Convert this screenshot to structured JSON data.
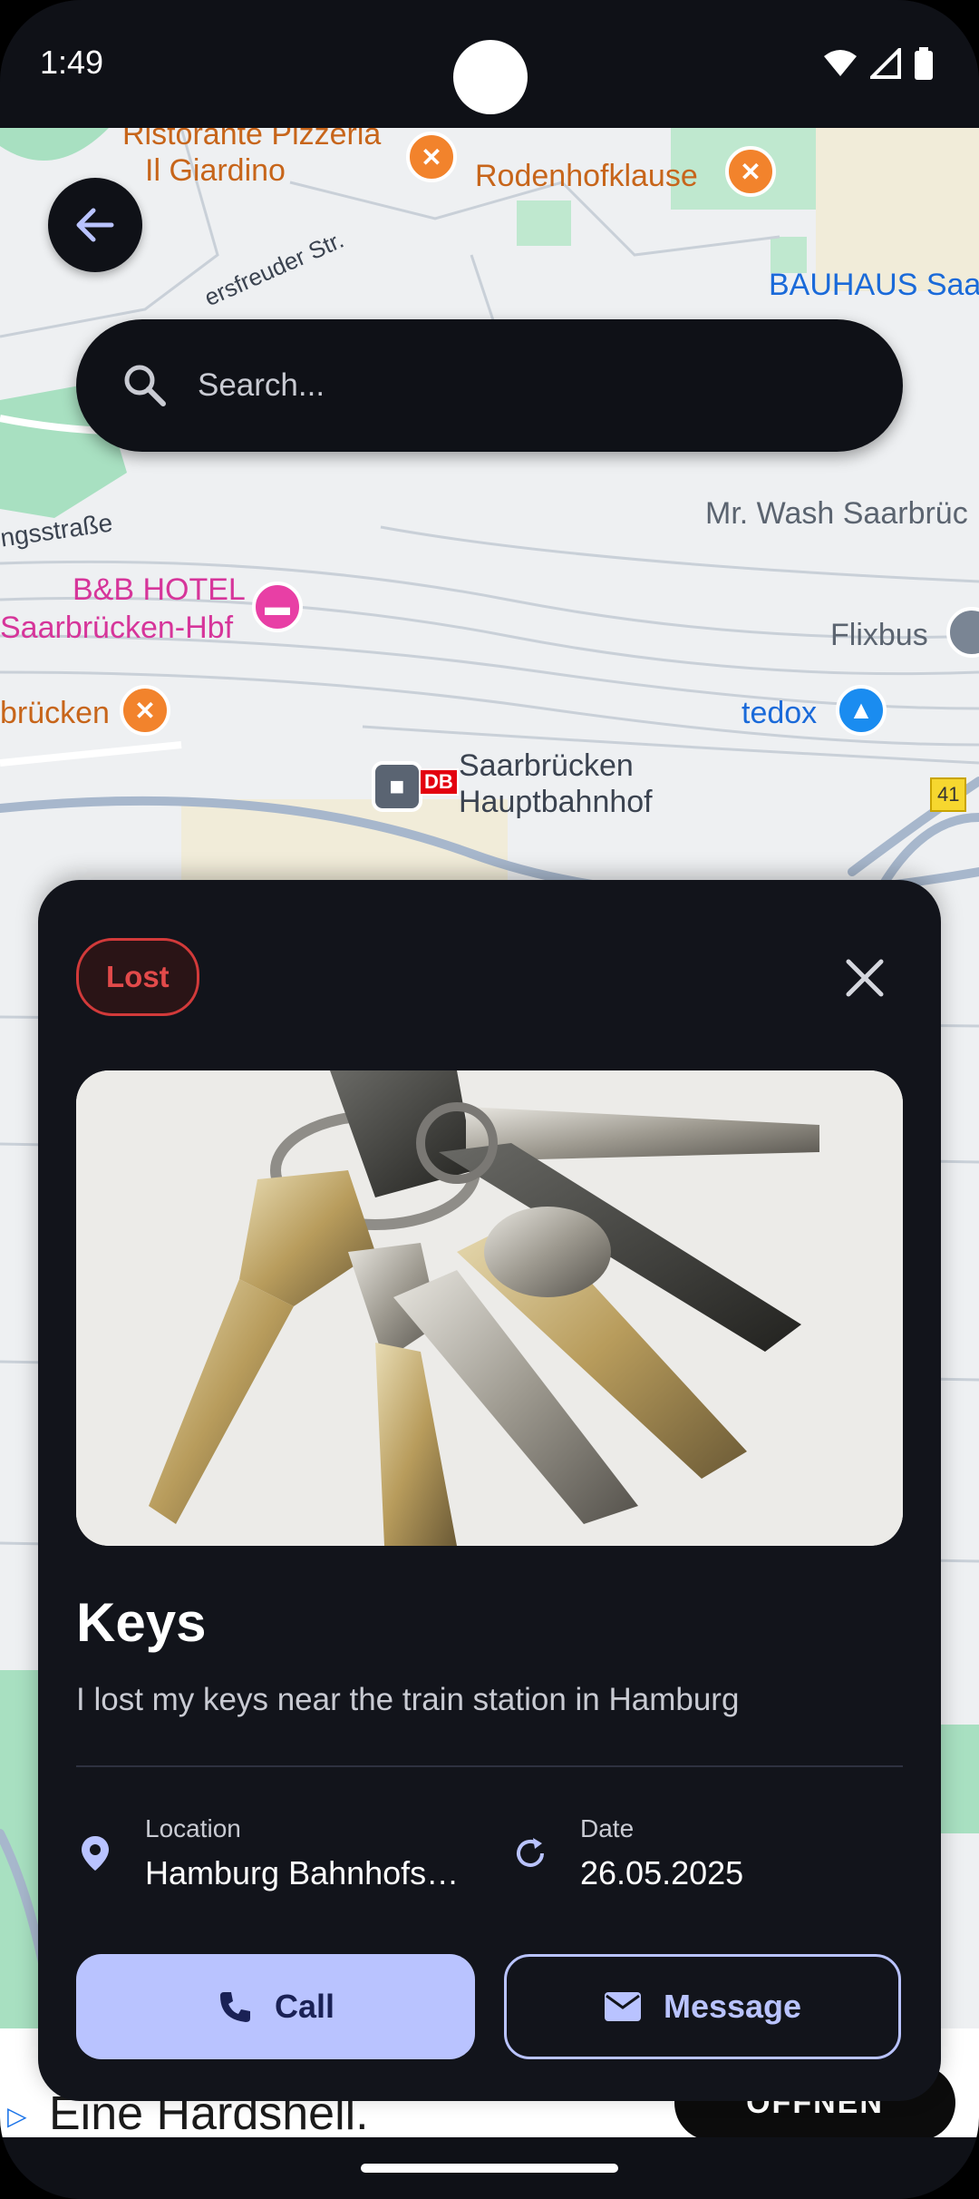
{
  "status_bar": {
    "time": "1:49"
  },
  "map": {
    "labels": {
      "ristorante": "Ristorante Pizzeria",
      "giardino": "Il Giardino",
      "rodenhof": "Rodenhofklause",
      "bauhaus": "BAUHAUS Saa",
      "street1": "ersfreuder Str.",
      "street2": "ngsstraße",
      "mrwash": "Mr. Wash Saarbrüc",
      "bbhotel": "B&B HOTEL",
      "saarhbf": "Saarbrücken-Hbf",
      "flixbus": "Flixbus",
      "brucken": "brücken",
      "tedox": "tedox",
      "db": "DB",
      "hbf1": "Saarbrücken",
      "hbf2": "Hauptbahnhof",
      "road41": "41"
    }
  },
  "search": {
    "placeholder": "Search..."
  },
  "card": {
    "status": "Lost",
    "title": "Keys",
    "description": "I lost my keys near the train station in Hamburg",
    "location_label": "Location",
    "location_value": "Hamburg Bahnhofs…",
    "date_label": "Date",
    "date_value": "26.05.2025",
    "call_label": "Call",
    "message_label": "Message"
  },
  "ad": {
    "text": "Eine Hardshell.",
    "button": "ÖFFNEN"
  },
  "colors": {
    "accent": "#b9c3ff",
    "lost": "#e24a4a",
    "surface": "#12141b"
  }
}
